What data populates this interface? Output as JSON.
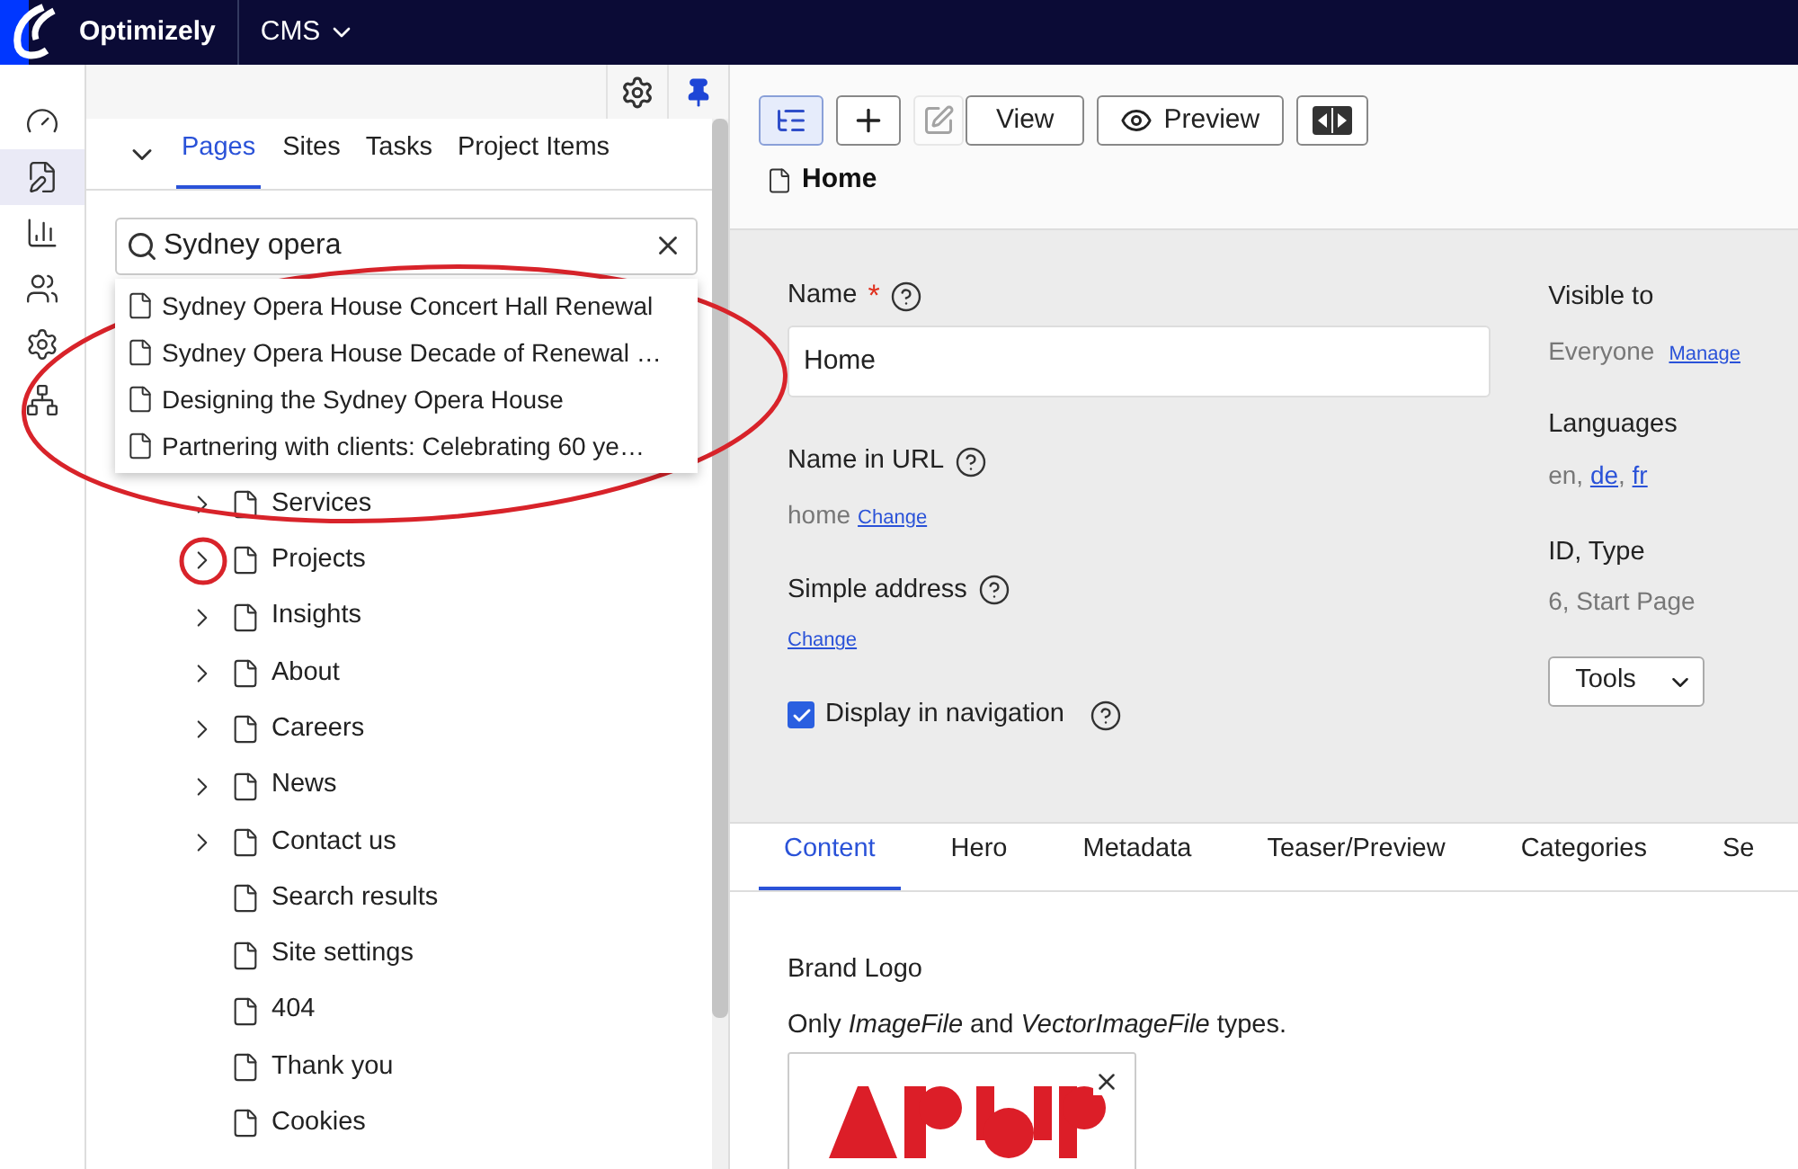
{
  "brand": {
    "name": "Optimizely",
    "product": "CMS"
  },
  "rail": [
    {
      "kind": "dashboard",
      "selected": false
    },
    {
      "kind": "edit",
      "selected": true
    },
    {
      "kind": "reports",
      "selected": false
    },
    {
      "kind": "users",
      "selected": false
    },
    {
      "kind": "settings",
      "selected": false
    },
    {
      "kind": "addons",
      "selected": false
    }
  ],
  "panel_tabs": [
    {
      "label": "Pages",
      "selected": true
    },
    {
      "label": "Sites",
      "selected": false
    },
    {
      "label": "Tasks",
      "selected": false
    },
    {
      "label": "Project Items",
      "selected": false
    }
  ],
  "search": {
    "value": "Sydney opera"
  },
  "suggestions": [
    "Sydney Opera House Concert Hall Renewal",
    "Sydney Opera House Decade of Renewal …",
    "Designing the Sydney Opera House",
    "Partnering with clients: Celebrating 60 ye…"
  ],
  "tree": [
    {
      "label": "Services",
      "has_children": true
    },
    {
      "label": "Projects",
      "has_children": true
    },
    {
      "label": "Insights",
      "has_children": true
    },
    {
      "label": "About",
      "has_children": true
    },
    {
      "label": "Careers",
      "has_children": true
    },
    {
      "label": "News",
      "has_children": true
    },
    {
      "label": "Contact us",
      "has_children": true
    },
    {
      "label": "Search results",
      "has_children": false
    },
    {
      "label": "Site settings",
      "has_children": false
    },
    {
      "label": "404",
      "has_children": false
    },
    {
      "label": "Thank you",
      "has_children": false
    },
    {
      "label": "Cookies",
      "has_children": false
    }
  ],
  "toolbar": [
    {
      "kind": "tree",
      "pressed": true,
      "disabled": false
    },
    {
      "kind": "add",
      "pressed": false,
      "disabled": false
    },
    {
      "kind": "edit",
      "pressed": false,
      "disabled": true
    },
    {
      "kind": "view",
      "label": "View",
      "pressed": false,
      "disabled": false
    },
    {
      "kind": "preview",
      "label": "Preview",
      "pressed": false,
      "disabled": false
    },
    {
      "kind": "compare",
      "pressed": false,
      "disabled": false
    }
  ],
  "page_title": "Home",
  "form": {
    "name_label": "Name",
    "required_mark": "*",
    "name_value": "Home",
    "url_label": "Name in URL",
    "url_value": "home",
    "url_link": "Change",
    "address_label": "Simple address",
    "address_link": "Change",
    "nav_label": "Display in navigation",
    "nav_checked": true
  },
  "info": {
    "visible_label": "Visible to",
    "visible_value": "Everyone",
    "manage_link": "Manage",
    "languages_label": "Languages",
    "languages": [
      {
        "text": "en, ",
        "link": false
      },
      {
        "text": "de",
        "link": true
      },
      {
        "text": ", ",
        "link": false
      },
      {
        "text": "fr",
        "link": true
      }
    ],
    "id_label": "ID, Type",
    "id_value": "6, Start Page",
    "tools_label": "Tools"
  },
  "content_tabs": [
    {
      "label": "Content",
      "selected": true
    },
    {
      "label": "Hero",
      "selected": false
    },
    {
      "label": "Metadata",
      "selected": false
    },
    {
      "label": "Teaser/Preview",
      "selected": false
    },
    {
      "label": "Categories",
      "selected": false
    },
    {
      "label": "Se",
      "selected": false
    }
  ],
  "brand_logo": {
    "label": "Brand Logo",
    "hint": "Only *ImageFile* and *VectorImageFile* types."
  }
}
